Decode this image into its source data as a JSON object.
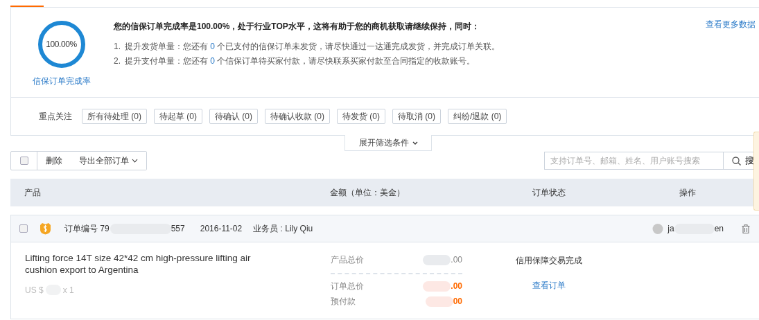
{
  "completion": {
    "rate_text": "100.00%",
    "label": "信保订单完成率",
    "headline": "您的信保订单完成率是100.00%，处于行业TOP水平，这将有助于您的商机获取请继续保持，同时：",
    "tips": [
      {
        "number": "1.",
        "before": "提升发货单量：您还有 ",
        "count": "0",
        "after": " 个已支付的信保订单未发货，请尽快通过一达通完成发货，并完成订单关联。"
      },
      {
        "number": "2.",
        "before": "提升支付单量：您还有 ",
        "count": "0",
        "after": " 个信保订单待买家付款，请尽快联系买家付款至合同指定的收款账号。"
      }
    ],
    "more_link": "查看更多数据"
  },
  "focus": {
    "label": "重点关注",
    "filters": [
      "所有待处理 (0)",
      "待起草 (0)",
      "待确认 (0)",
      "待确认收款 (0)",
      "待发货 (0)",
      "待取消 (0)",
      "纠纷/退款 (0)"
    ]
  },
  "expand_filter": "展开筛选条件",
  "toolbar": {
    "select_all_checked": false,
    "delete": "删除",
    "export": "导出全部订单",
    "search": {
      "placeholder": "支持订单号、邮箱、姓名、用户账号搜索",
      "button": "搜"
    }
  },
  "table": {
    "columns": [
      "产品",
      "金额（单位：美金）",
      "订单状态",
      "操作"
    ],
    "orders": [
      {
        "checked": false,
        "order_number": {
          "before": "订单编号 79",
          "after": "557"
        },
        "date": "2016-11-02",
        "salesperson": "业务员 : Lily Qiu",
        "customer": {
          "before": "ja",
          "after": "en"
        },
        "product": "Lifting force 14T size 42*42 cm high-pressure lifting air cushion export to Argentina",
        "price": {
          "before": "US $",
          "after": "x 1"
        },
        "amounts": [
          {
            "label": "产品总价",
            "value": ".00",
            "highlight": false
          },
          {
            "label": "订单总价",
            "value": ".00",
            "highlight": true
          },
          {
            "label": "预付款",
            "value": "00",
            "highlight": true
          }
        ],
        "status": "信用保障交易完成",
        "action": "查看订单"
      }
    ]
  }
}
